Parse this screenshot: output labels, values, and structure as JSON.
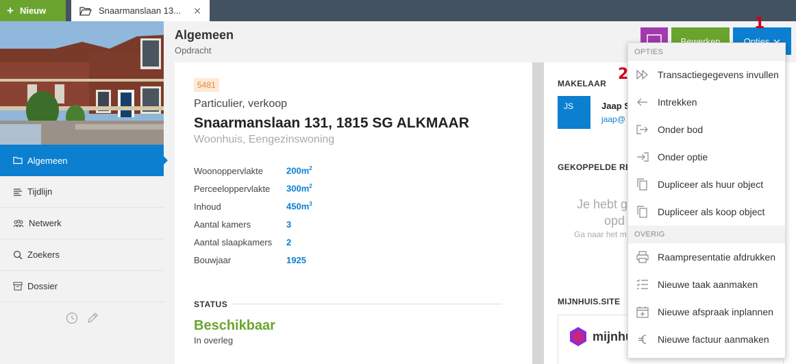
{
  "topbar": {
    "new_label": "Nieuw",
    "tab_title": "Snaarmanslaan 13...",
    "tab_close": "✕"
  },
  "sidebar": {
    "items": [
      {
        "label": "Algemeen",
        "icon": "folder-icon",
        "active": true
      },
      {
        "label": "Tijdlijn",
        "icon": "timeline-icon",
        "active": false
      },
      {
        "label": "Netwerk",
        "icon": "network-icon",
        "active": false
      },
      {
        "label": "Zoekers",
        "icon": "search-icon",
        "active": false
      },
      {
        "label": "Dossier",
        "icon": "archive-icon",
        "active": false
      }
    ]
  },
  "header": {
    "title": "Algemeen",
    "subtitle": "Opdracht",
    "edit_label": "Bewerken",
    "options_label": "Opties"
  },
  "property": {
    "id": "5481",
    "type": "Particulier, verkoop",
    "address": "Snaarmanslaan 131, 1815 SG ALKMAAR",
    "subtype": "Woonhuis, Eengezinswoning",
    "specs": [
      {
        "label": "Woonoppervlakte",
        "value": "200m",
        "sup": "2"
      },
      {
        "label": "Perceeloppervlakte",
        "value": "300m",
        "sup": "2"
      },
      {
        "label": "Inhoud",
        "value": "450m",
        "sup": "3"
      },
      {
        "label": "Aantal kamers",
        "value": "3",
        "sup": ""
      },
      {
        "label": "Aantal slaapkamers",
        "value": "2",
        "sup": ""
      },
      {
        "label": "Bouwjaar",
        "value": "1925",
        "sup": ""
      }
    ],
    "status_heading": "STATUS",
    "status": "Beschikbaar",
    "status_sub": "In overleg"
  },
  "right": {
    "agent_heading": "MAKELAAR",
    "agent_initials": "JS",
    "agent_name": "Jaap S",
    "agent_email": "jaap@",
    "linked_heading": "GEKOPPELDE RE",
    "empty_line1": "Je hebt g",
    "empty_line2": "opd",
    "empty_sub": "Ga naar het m",
    "site_heading": "MIJNHUIS.SITE",
    "site_logo_text": "mijnhui"
  },
  "dropdown": {
    "section_options": "OPTIES",
    "options": [
      {
        "label": "Transactiegegevens invullen",
        "icon": "fast-forward-icon"
      },
      {
        "label": "Intrekken",
        "icon": "arrow-left-icon"
      },
      {
        "label": "Onder bod",
        "icon": "sign-out-icon"
      },
      {
        "label": "Onder optie",
        "icon": "sign-in-icon"
      },
      {
        "label": "Dupliceer als huur object",
        "icon": "copy-icon"
      },
      {
        "label": "Dupliceer als koop object",
        "icon": "copy-icon"
      }
    ],
    "section_other": "OVERIG",
    "other": [
      {
        "label": "Raampresentatie afdrukken",
        "icon": "printer-icon"
      },
      {
        "label": "Nieuwe taak aanmaken",
        "icon": "tasklist-icon"
      },
      {
        "label": "Nieuwe afspraak inplannen",
        "icon": "calendar-plus-icon"
      },
      {
        "label": "Nieuwe factuur aanmaken",
        "icon": "euro-icon"
      }
    ]
  },
  "annotations": {
    "step1": "1",
    "step2": "2"
  },
  "colors": {
    "green": "#6aa42e",
    "blue": "#0c7fd0",
    "purple": "#a03aad",
    "topbar": "#435260"
  }
}
